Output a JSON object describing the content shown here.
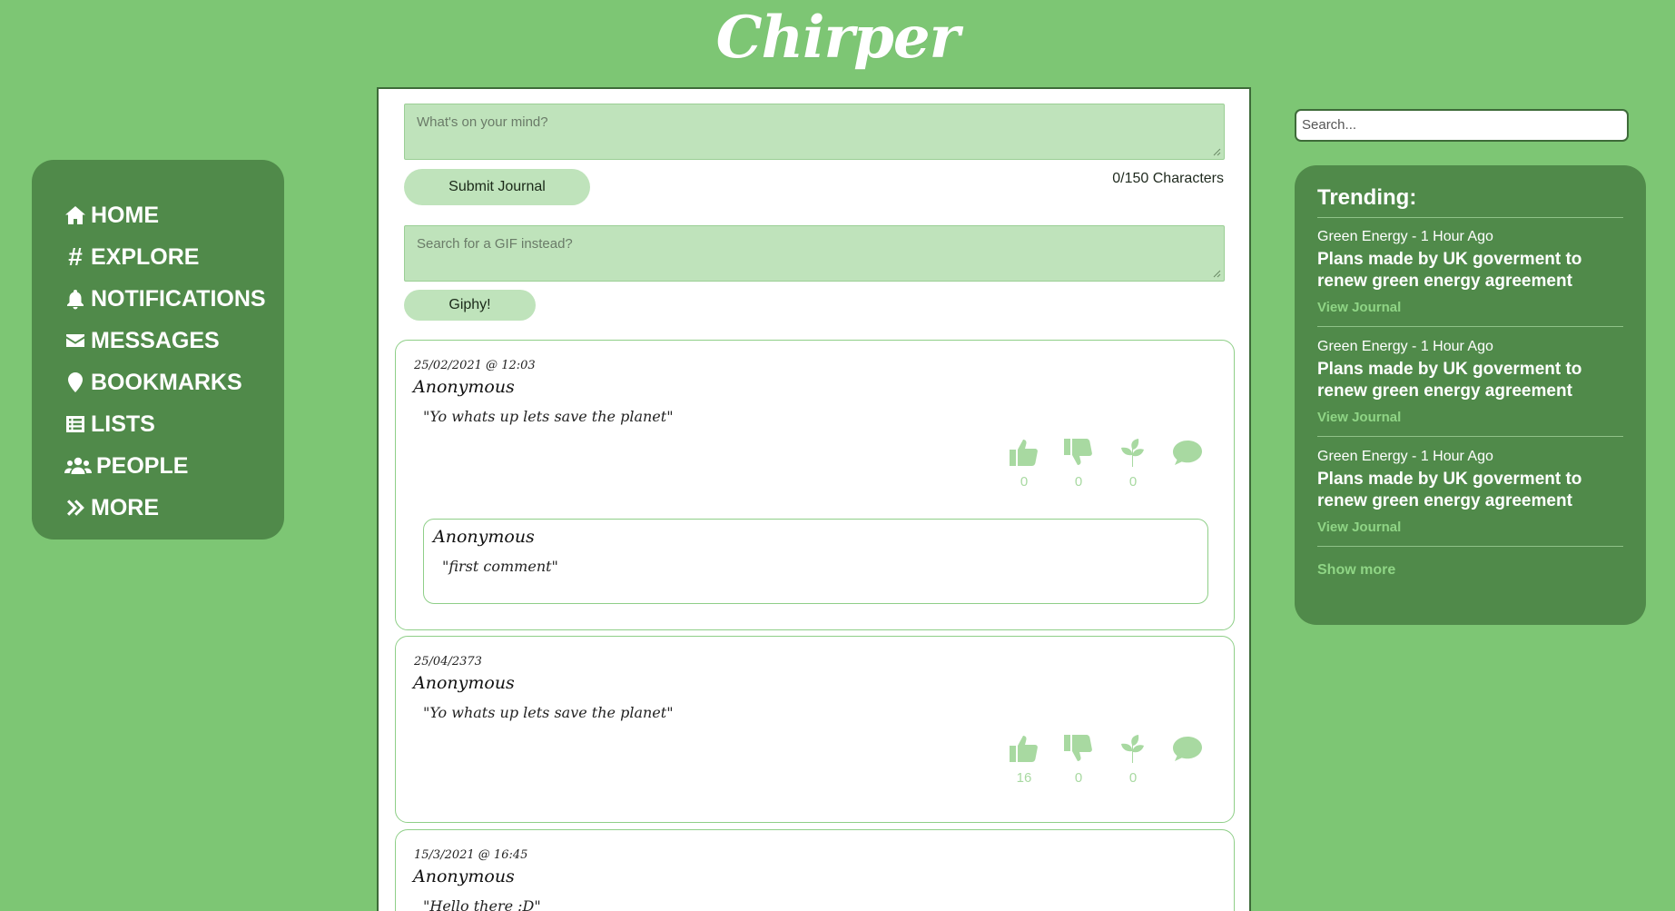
{
  "brand": {
    "logo": "Chirper"
  },
  "nav": {
    "items": [
      {
        "label": "HOME",
        "icon": "home-icon"
      },
      {
        "label": "EXPLORE",
        "icon": "hash-icon"
      },
      {
        "label": "NOTIFICATIONS",
        "icon": "bell-icon"
      },
      {
        "label": "MESSAGES",
        "icon": "envelope-icon"
      },
      {
        "label": "BOOKMARKS",
        "icon": "map-pin-icon"
      },
      {
        "label": "LISTS",
        "icon": "list-icon"
      },
      {
        "label": "PEOPLE",
        "icon": "users-icon"
      },
      {
        "label": "MORE",
        "icon": "double-chevron-right-icon"
      }
    ]
  },
  "composer": {
    "placeholder": "What's on your mind?",
    "submit_label": "Submit Journal",
    "char_count": "0/150 Characters",
    "gif_placeholder": "Search for a GIF instead?",
    "giphy_label": "Giphy!"
  },
  "posts": [
    {
      "date": "25/02/2021 @ 12:03",
      "author": "Anonymous",
      "text": "\"Yo whats up lets save the planet\"",
      "likes": "0",
      "dislikes": "0",
      "plants": "0",
      "comment": {
        "author": "Anonymous",
        "text": "\"first comment\""
      }
    },
    {
      "date": "25/04/2373",
      "author": "Anonymous",
      "text": "\"Yo whats up lets save the planet\"",
      "likes": "16",
      "dislikes": "0",
      "plants": "0"
    },
    {
      "date": "15/3/2021 @ 16:45",
      "author": "Anonymous",
      "text": "\"Hello there :D\""
    }
  ],
  "search": {
    "placeholder": "Search..."
  },
  "trending": {
    "heading": "Trending:",
    "items": [
      {
        "meta": "Green Energy - 1 Hour Ago",
        "title": "Plans made by UK goverment to renew green energy agreement",
        "link": "View Journal"
      },
      {
        "meta": "Green Energy - 1 Hour Ago",
        "title": "Plans made by UK goverment to renew green energy agreement",
        "link": "View Journal"
      },
      {
        "meta": "Green Energy - 1 Hour Ago",
        "title": "Plans made by UK goverment to renew green energy agreement",
        "link": "View Journal"
      }
    ],
    "show_more": "Show more"
  },
  "colors": {
    "background": "#7dc674",
    "panel": "#508a4a",
    "input": "#bfe3bb",
    "accent_light": "#a8d9a1"
  }
}
